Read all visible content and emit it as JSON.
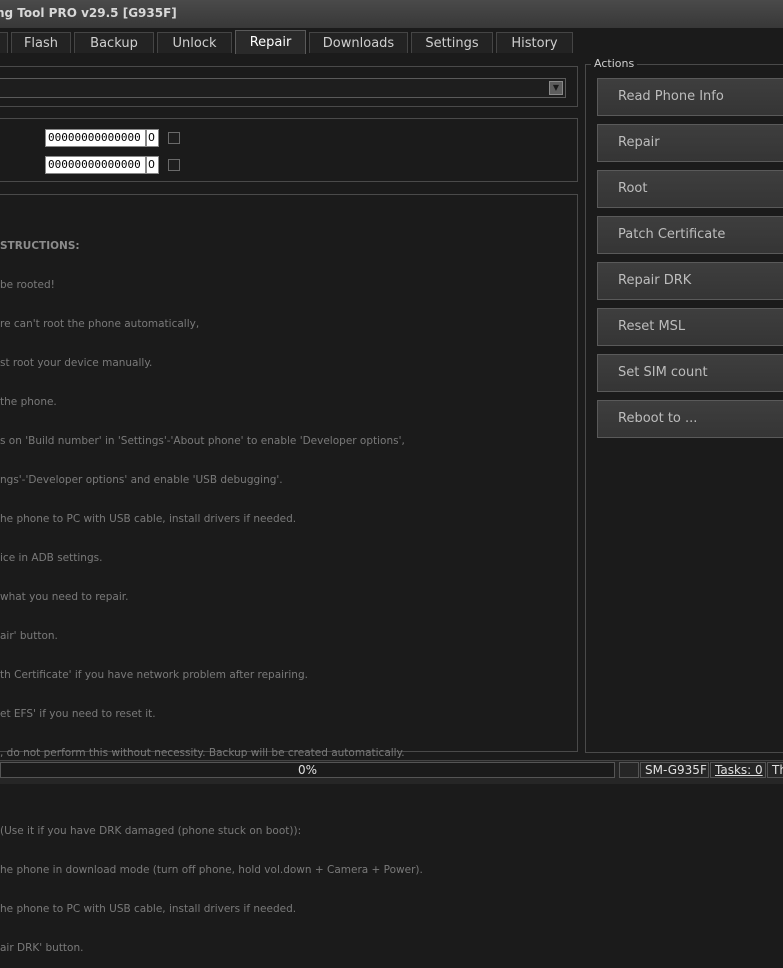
{
  "window": {
    "title": "ng Tool PRO v29.5 [G935F]"
  },
  "tabs": [
    {
      "label": "Flash"
    },
    {
      "label": "Backup"
    },
    {
      "label": "Unlock"
    },
    {
      "label": "Repair",
      "active": true
    },
    {
      "label": "Downloads"
    },
    {
      "label": "Settings"
    },
    {
      "label": "History"
    }
  ],
  "imei_fields": [
    {
      "value": "00000000000000",
      "count": "0",
      "checked": false
    },
    {
      "value": "00000000000000",
      "count": "0",
      "checked": false
    }
  ],
  "instructions": [
    "STRUCTIONS:",
    "be rooted!",
    "re can't root the phone automatically,",
    "st root your device manually.",
    "the phone.",
    "s on 'Build number' in 'Settings'-'About phone' to enable 'Developer options',",
    "ngs'-'Developer options' and enable 'USB debugging'.",
    "he phone to PC with USB cable, install drivers if needed.",
    "ice in ADB settings.",
    "what you need to repair.",
    "air' button.",
    "th Certificate' if you have network problem after repairing.",
    "et EFS' if you need to reset it.",
    ", do not perform this without necessity. Backup will be created automatically.",
    "",
    "(Use it if you have DRK damaged (phone stuck on boot)):",
    "he phone in download mode (turn off phone, hold vol.down + Camera + Power).",
    "he phone to PC with USB cable, install drivers if needed.",
    "air DRK' button."
  ],
  "actions": {
    "title": "Actions",
    "buttons": [
      {
        "label": "Read Phone Info"
      },
      {
        "label": "Repair"
      },
      {
        "label": "Root"
      },
      {
        "label": "Patch Certificate"
      },
      {
        "label": "Repair DRK"
      },
      {
        "label": "Reset MSL"
      },
      {
        "label": "Set SIM count"
      },
      {
        "label": "Reboot to ..."
      }
    ]
  },
  "status": {
    "progress_text": "0%",
    "progress": 0,
    "model": "SM-G935F",
    "tasks": "Tasks: 0",
    "extra": "Th"
  }
}
